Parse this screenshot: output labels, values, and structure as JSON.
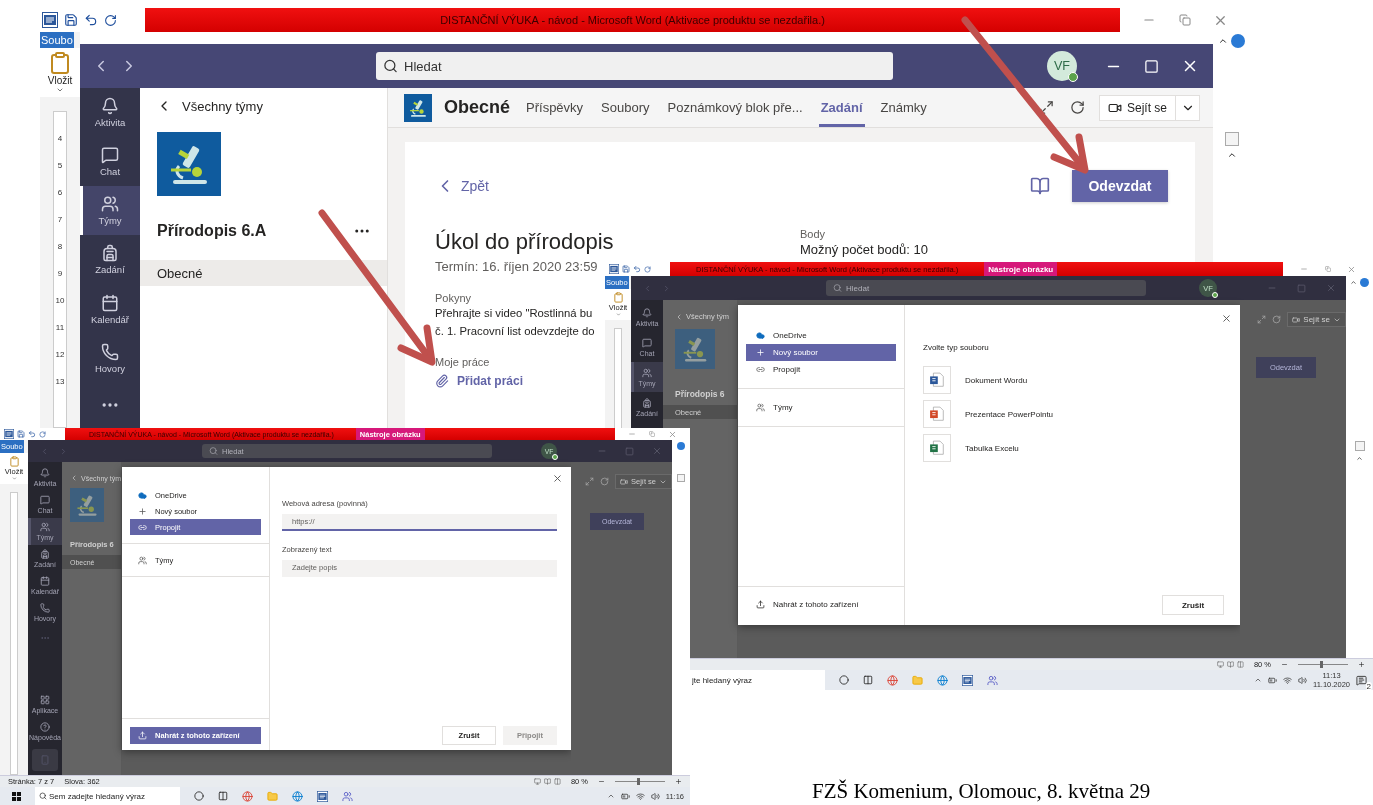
{
  "main": {
    "word": {
      "title": "DISTANČNÍ VÝUKA - návod  -  Microsoft Word (Aktivace produktu se nezdařila.)",
      "file_tab": "Soubo",
      "paste": "Vložit",
      "ruler_marks": [
        "4",
        "5",
        "6",
        "7",
        "8",
        "9",
        "10",
        "11",
        "12",
        "13"
      ]
    },
    "search": {
      "placeholder": "Hledat"
    },
    "avatar": "VF",
    "rail": [
      {
        "kind": "activity",
        "label": "Aktivita",
        "selected": false
      },
      {
        "kind": "chat",
        "label": "Chat",
        "selected": false
      },
      {
        "kind": "teams",
        "label": "Týmy",
        "selected": true
      },
      {
        "kind": "assignments",
        "label": "Zadání",
        "selected": false
      },
      {
        "kind": "calendar",
        "label": "Kalendář",
        "selected": false
      },
      {
        "kind": "calls",
        "label": "Hovory",
        "selected": false
      }
    ],
    "back_link": "Všechny týmy",
    "team_name": "Přírodopis 6.A",
    "channels": [
      {
        "label": "Obecné",
        "selected": true
      }
    ],
    "channel_title": "Obecné",
    "tabs": [
      {
        "label": "Příspěvky",
        "selected": false
      },
      {
        "label": "Soubory",
        "selected": false
      },
      {
        "label": "Poznámkový blok pře...",
        "selected": false
      },
      {
        "label": "Zadání",
        "selected": true
      },
      {
        "label": "Známky",
        "selected": false
      }
    ],
    "meet_button": "Sejít se",
    "assignment": {
      "back": "Zpět",
      "submit": "Odevzdat",
      "title": "Úkol do přírodopis",
      "due": "Termín: 16. říjen 2020 23:59",
      "instructions_label": "Pokyny",
      "instructions_lines": [
        "Přehrajte si video \"Rostlinná bu",
        "č. 1. Pracovní list odevzdejte do"
      ],
      "my_work_label": "Moje práce",
      "add_work": "Přidat práci",
      "points_label": "Body",
      "points": "Možný počet bodů: 10"
    }
  },
  "new_file": {
    "word": {
      "title": "DISTANČNÍ VÝUKA - návod  -  Microsoft Word (Aktivace produktu se nezdařila.)",
      "tools_tab": "Nástroje obrázku",
      "file_tab": "Soubo",
      "paste": "Vložit"
    },
    "search": {
      "placeholder": "Hledat"
    },
    "avatar": "VF",
    "rail": [
      {
        "kind": "activity",
        "label": "Aktivita",
        "selected": false
      },
      {
        "kind": "chat",
        "label": "Chat",
        "selected": false
      },
      {
        "kind": "teams",
        "label": "Týmy",
        "selected": true
      },
      {
        "kind": "assignments",
        "label": "Zadání",
        "selected": false
      }
    ],
    "back_link": "Všechny tým",
    "team_name": "Přírodopis 6",
    "channels": [
      {
        "label": "Obecné",
        "selected": true
      }
    ],
    "meet_button": "Sejít se",
    "submit": "Odevzdat",
    "dialog": {
      "kind": "file_types",
      "sources": [
        {
          "kind": "cloud",
          "label": "OneDrive",
          "selected": false
        },
        {
          "kind": "plus",
          "label": "Nový soubor",
          "selected": true
        },
        {
          "kind": "link",
          "label": "Propojit",
          "selected": false
        }
      ],
      "teams_item": "Týmy",
      "upload": {
        "label": "Nahrát z tohoto zařízení",
        "highlighted": false
      },
      "heading": "Zvolte typ souboru",
      "file_types": [
        {
          "kind": "word",
          "label": "Dokument Wordu"
        },
        {
          "kind": "powerpoint",
          "label": "Prezentace PowerPointu"
        },
        {
          "kind": "excel",
          "label": "Tabulka Excelu"
        }
      ],
      "cancel": "Zrušit"
    },
    "status_bar": {
      "zoom": "80 %",
      "zoom_slider": {
        "level": 0.45
      }
    },
    "taskbar": {
      "search": {
        "placeholder": "jte hledaný výraz"
      },
      "time": "11:13",
      "date": "11.10.2020",
      "notifications": "2"
    }
  },
  "link": {
    "word": {
      "title": "DISTANČNÍ VÝUKA - návod  -  Microsoft Word (Aktivace produktu se nezdařila.)",
      "tools_tab": "Nástroje obrázku",
      "file_tab": "Soubo",
      "paste": "Vložit"
    },
    "search": {
      "placeholder": "Hledat"
    },
    "avatar": "VF",
    "rail": [
      {
        "kind": "activity",
        "label": "Aktivita",
        "selected": false
      },
      {
        "kind": "chat",
        "label": "Chat",
        "selected": false
      },
      {
        "kind": "teams",
        "label": "Týmy",
        "selected": true
      },
      {
        "kind": "assignments",
        "label": "Zadání",
        "selected": false
      },
      {
        "kind": "calendar",
        "label": "Kalendář",
        "selected": false
      },
      {
        "kind": "calls",
        "label": "Hovory",
        "selected": false
      }
    ],
    "rail_bottom": [
      {
        "kind": "apps",
        "label": "Aplikace",
        "selected": false
      },
      {
        "kind": "help",
        "label": "Nápověda",
        "selected": false
      }
    ],
    "back_link": "Všechny tým",
    "team_name": "Přírodopis 6",
    "channels": [
      {
        "label": "Obecné",
        "selected": true
      }
    ],
    "meet_button": "Sejít se",
    "submit": "Odevzdat",
    "dialog": {
      "kind": "link_form",
      "sources": [
        {
          "kind": "cloud",
          "label": "OneDrive",
          "selected": false
        },
        {
          "kind": "plus",
          "label": "Nový soubor",
          "selected": false
        },
        {
          "kind": "link",
          "label": "Propojit",
          "selected": true
        }
      ],
      "teams_item": "Týmy",
      "upload": {
        "label": "Nahrát z tohoto zařízení",
        "highlighted": true
      },
      "url_field": {
        "label": "Webová adresa (povinná)",
        "value": "https://"
      },
      "text_field": {
        "label": "Zobrazený text",
        "placeholder": "Zadejte popis"
      },
      "cancel": "Zrušit",
      "connect": {
        "label": "Připojit",
        "disabled": true
      }
    },
    "status_bar": {
      "page": "Stránka: 7 z 7",
      "words": "Slova: 362",
      "zoom": "80 %",
      "zoom_slider": {
        "level": 0.45
      }
    },
    "taskbar": {
      "search": {
        "placeholder": "Sem zadejte hledaný výraz"
      },
      "time": "11:16"
    }
  },
  "footer": "FZŠ Komenium, Olomouc, 8. května 29"
}
